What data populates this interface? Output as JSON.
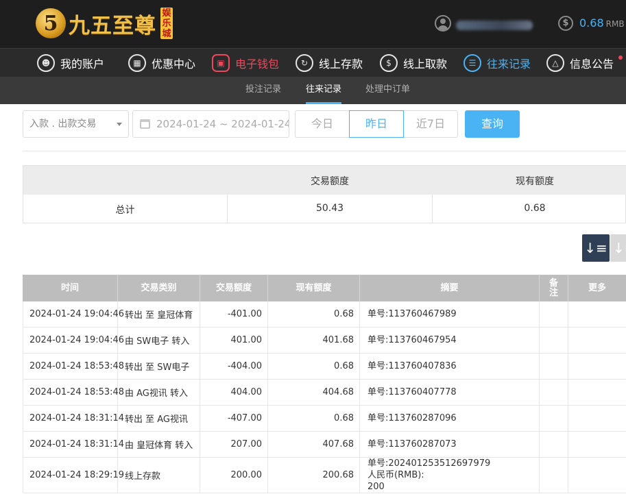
{
  "header": {
    "logo_text": "九五至尊",
    "logo_tag": "娱乐城",
    "balance": "0.68",
    "balance_unit": "RMB"
  },
  "nav": {
    "items": [
      {
        "label": "我的账户",
        "icon": "user-icon"
      },
      {
        "label": "优惠中心",
        "icon": "gift-icon"
      },
      {
        "label": "电子钱包",
        "icon": "wallet-icon"
      },
      {
        "label": "线上存款",
        "icon": "deposit-icon"
      },
      {
        "label": "线上取款",
        "icon": "withdraw-icon"
      },
      {
        "label": "往来记录",
        "icon": "records-icon"
      },
      {
        "label": "信息公告",
        "icon": "bell-icon"
      }
    ],
    "active_label": "往来记录",
    "highlight_color": "#f0475a",
    "accent_color": "#4ab3f4"
  },
  "subnav": {
    "tabs": [
      "投注记录",
      "往来记录",
      "处理中订单"
    ],
    "active": "往来记录"
  },
  "filter": {
    "type_select": "入款 . 出款交易",
    "date_range": "2024-01-24 ~ 2024-01-24",
    "today": "今日",
    "yesterday": "昨日",
    "last7": "近7日",
    "query": "查询"
  },
  "summary": {
    "col_amount": "交易额度",
    "col_balance": "现有额度",
    "row_label": "总计",
    "amount": "50.43",
    "balance": "0.68"
  },
  "table": {
    "headers": {
      "time": "时间",
      "type": "交易类别",
      "amount": "交易额度",
      "balance": "现有额度",
      "memo": "摘要",
      "note": "备注",
      "more": "更多"
    },
    "rows": [
      {
        "time": "2024-01-24 19:04:46",
        "type": "转出 至 皇冠体育",
        "amount": "-401.00",
        "balance": "0.68",
        "memo": "单号:113760467989"
      },
      {
        "time": "2024-01-24 19:04:46",
        "type": "由 SW电子 转入",
        "amount": "401.00",
        "balance": "401.68",
        "memo": "单号:113760467954"
      },
      {
        "time": "2024-01-24 18:53:48",
        "type": "转出 至 SW电子",
        "amount": "-404.00",
        "balance": "0.68",
        "memo": "单号:113760407836"
      },
      {
        "time": "2024-01-24 18:53:48",
        "type": "由 AG视讯 转入",
        "amount": "404.00",
        "balance": "404.68",
        "memo": "单号:113760407778"
      },
      {
        "time": "2024-01-24 18:31:14",
        "type": "转出 至 AG视讯",
        "amount": "-407.00",
        "balance": "0.68",
        "memo": "单号:113760287096"
      },
      {
        "time": "2024-01-24 18:31:14",
        "type": "由 皇冠体育 转入",
        "amount": "207.00",
        "balance": "407.68",
        "memo": "单号:113760287073"
      },
      {
        "time": "2024-01-24 18:29:19",
        "type": "线上存款",
        "amount": "200.00",
        "balance": "200.68",
        "memo_lines": [
          "单号:202401253512697979",
          "人民币(RMB):",
          "200"
        ]
      }
    ]
  }
}
